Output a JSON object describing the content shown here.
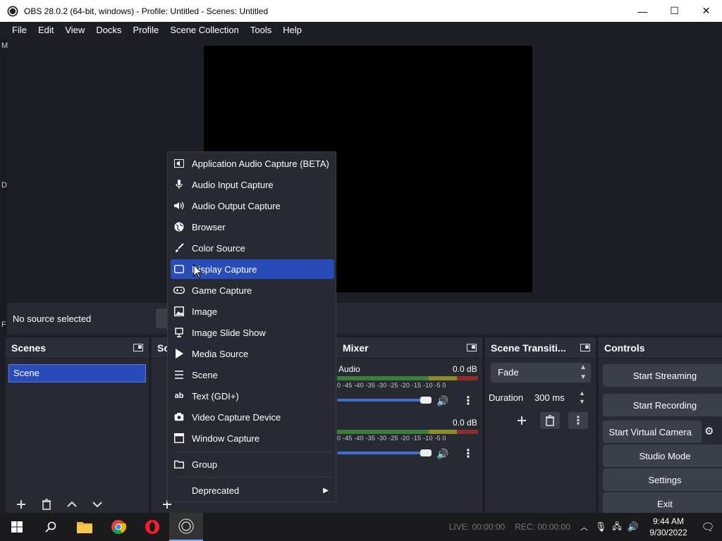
{
  "window": {
    "title": "OBS 28.0.2 (64-bit, windows) - Profile: Untitled - Scenes: Untitled",
    "minimize": "—",
    "maximize": "☐",
    "close": "✕"
  },
  "menu": [
    "File",
    "Edit",
    "View",
    "Docks",
    "Profile",
    "Scene Collection",
    "Tools",
    "Help"
  ],
  "left_strip_letters": [
    "M",
    "D",
    "F"
  ],
  "source_bar": {
    "no_source": "No source selected"
  },
  "scenes": {
    "title": "Scenes",
    "items": [
      "Scene"
    ]
  },
  "sources": {
    "title_partial": "So"
  },
  "mixer": {
    "title": "Mixer",
    "tracks": [
      {
        "name": "Audio",
        "db": "0.0 dB",
        "level": 0.0
      },
      {
        "name": "",
        "db": "0.0 dB",
        "level": 0.0
      }
    ],
    "scale": "0 -45 -40 -35 -30 -25 -20 -15 -10 -5 0"
  },
  "transitions": {
    "title": "Scene Transiti...",
    "selected": "Fade",
    "duration_label": "Duration",
    "duration_value": "300 ms"
  },
  "controls": {
    "title": "Controls",
    "buttons": {
      "start_streaming": "Start Streaming",
      "start_recording": "Start Recording",
      "start_virtual_camera": "Start Virtual Camera",
      "studio_mode": "Studio Mode",
      "settings": "Settings",
      "exit": "Exit"
    }
  },
  "context_menu": {
    "items": [
      {
        "label": "Application Audio Capture (BETA)",
        "icon": "app-audio-icon"
      },
      {
        "label": "Audio Input Capture",
        "icon": "microphone-icon"
      },
      {
        "label": "Audio Output Capture",
        "icon": "speaker-icon"
      },
      {
        "label": "Browser",
        "icon": "globe-icon"
      },
      {
        "label": "Color Source",
        "icon": "brush-icon"
      },
      {
        "label": "Display Capture",
        "icon": "monitor-icon",
        "selected": true
      },
      {
        "label": "Game Capture",
        "icon": "gamepad-icon"
      },
      {
        "label": "Image",
        "icon": "image-icon"
      },
      {
        "label": "Image Slide Show",
        "icon": "slideshow-icon"
      },
      {
        "label": "Media Source",
        "icon": "play-icon"
      },
      {
        "label": "Scene",
        "icon": "list-icon"
      },
      {
        "label": "Text (GDI+)",
        "icon": "text-icon"
      },
      {
        "label": "Video Capture Device",
        "icon": "camera-icon"
      },
      {
        "label": "Window Capture",
        "icon": "window-icon"
      }
    ],
    "group": "Group",
    "deprecated": "Deprecated"
  },
  "taskbar": {
    "live": "LIVE: 00:00:00",
    "rec": "REC: 00:00:00",
    "time": "9:44 AM",
    "date": "9/30/2022"
  },
  "colors": {
    "accent": "#284cb8",
    "panel": "#272a33",
    "background": "#1e1f26",
    "button": "#3c404b"
  }
}
